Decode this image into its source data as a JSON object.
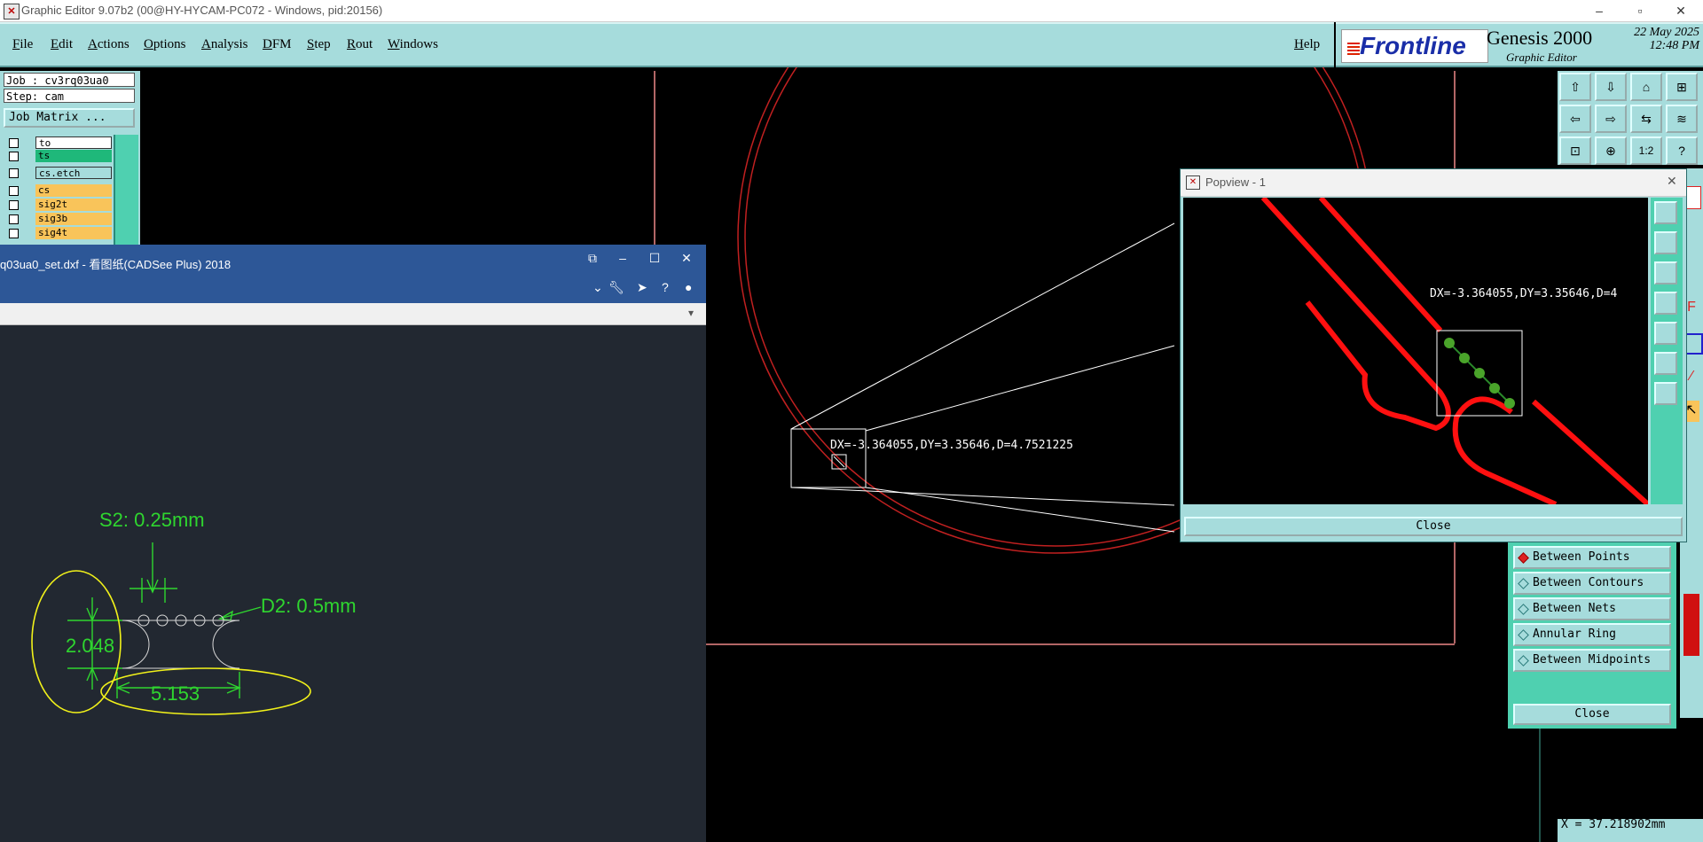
{
  "window": {
    "title": "Graphic Editor 9.07b2 (00@HY-HYCAM-PC072 - Windows, pid:20156)",
    "controls": {
      "minimize": "–",
      "maximize": "▫",
      "close": "✕"
    }
  },
  "menu": {
    "items": [
      "File",
      "Edit",
      "Actions",
      "Options",
      "Analysis",
      "DFM",
      "Step",
      "Rout",
      "Windows"
    ],
    "help": "Help"
  },
  "brand": {
    "logo": "Frontline",
    "product": "Genesis 2000",
    "subtitle": "Graphic Editor",
    "date": "22 May 2025",
    "time": "12:48 PM"
  },
  "job": {
    "job_line": "Job : cv3rq03ua0",
    "step_line": "Step: cam",
    "matrix_button": "Job Matrix ..."
  },
  "layers": [
    {
      "name": "to",
      "color": "#ffffff"
    },
    {
      "name": "ts",
      "color": "#1fb87a"
    },
    {
      "name": "cs.etch",
      "color": "#a6dcdc"
    },
    {
      "name": "cs",
      "color": "#f9c45a"
    },
    {
      "name": "sig2t",
      "color": "#f9c45a"
    },
    {
      "name": "sig3b",
      "color": "#f9c45a"
    },
    {
      "name": "sig4t",
      "color": "#f9c45a"
    }
  ],
  "cadsee": {
    "title": "q03ua0_set.dxf - 看图纸(CADSee Plus) 2018",
    "annotations": {
      "s2": "S2: 0.25mm",
      "d2": "D2: 0.5mm",
      "height": "2.048",
      "width": "5.153"
    }
  },
  "main_canvas": {
    "measure_text": "DX=-3.364055,DY=3.35646,D=4.7521225"
  },
  "popview": {
    "title": "Popview - 1",
    "measure_text": "DX=-3.364055,DY=3.35646,D=4",
    "close_label": "Close"
  },
  "measure_panel": {
    "options": [
      "Between Points",
      "Between Contours",
      "Between Nets",
      "Annular Ring",
      "Between Midpoints"
    ],
    "selected_index": 0,
    "close_label": "Close"
  },
  "status": {
    "x_readout": "X = 37.218902mm"
  },
  "colors": {
    "panel": "#a6dcdc",
    "panel_dark": "#4fd0b0",
    "trace_red": "#ff1010",
    "circle_red": "#c02020",
    "dim_green": "#2fd62f",
    "highlight_yellow": "#f2f21a",
    "cadsee_blue": "#2d5797"
  },
  "icons": {
    "app": "genesis-app-icon",
    "popview": "popview-window-icon"
  }
}
